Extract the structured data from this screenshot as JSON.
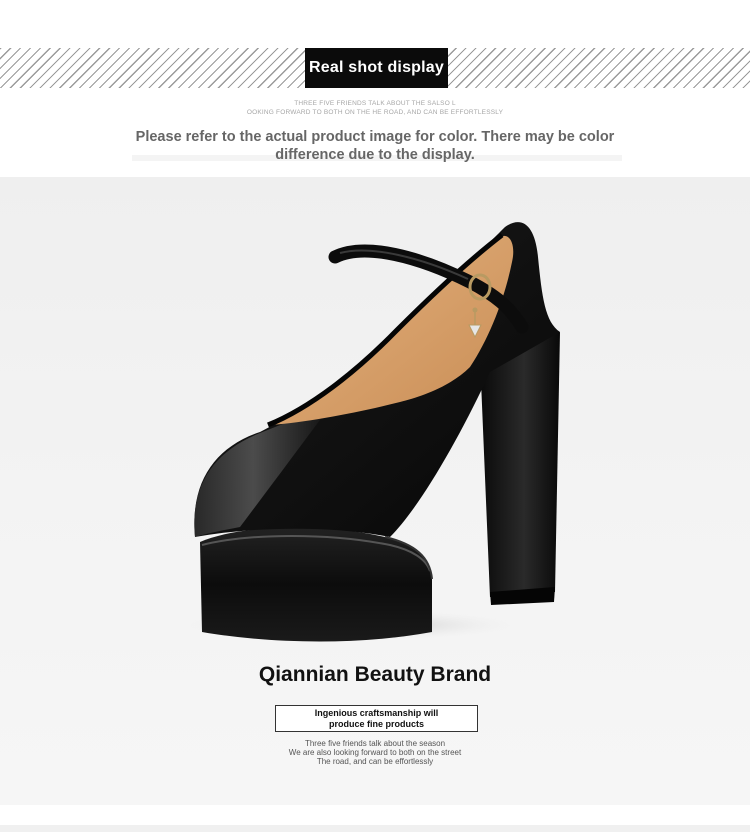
{
  "header": {
    "title": "Real shot display",
    "tiny_line_1": "THREE FIVE FRIENDS TALK ABOUT THE SALSO L",
    "tiny_line_2": "OOKING FORWARD TO BOTH ON THE HE ROAD, AND CAN BE EFFORTLESSLY"
  },
  "notice": {
    "line_1": "Please refer to the actual product image for color. There may be color",
    "line_2": "difference due to the display."
  },
  "brand": {
    "name": "Qiannian Beauty Brand",
    "tag_line_1": "Ingenious craftsmanship will",
    "tag_line_2": "produce fine products"
  },
  "slogan": {
    "line_1": "Three five friends talk about the season",
    "line_2": "We are also looking forward to both on the street",
    "line_3": "The road, and can be effortlessly"
  },
  "colors": {
    "title_bg": "#0b0b0b",
    "stripe": "#9a9a9a",
    "notice_text": "#666666",
    "photo_bg": "#f0f0f0",
    "shoe": "#111111",
    "lining": "#d9a16a"
  }
}
